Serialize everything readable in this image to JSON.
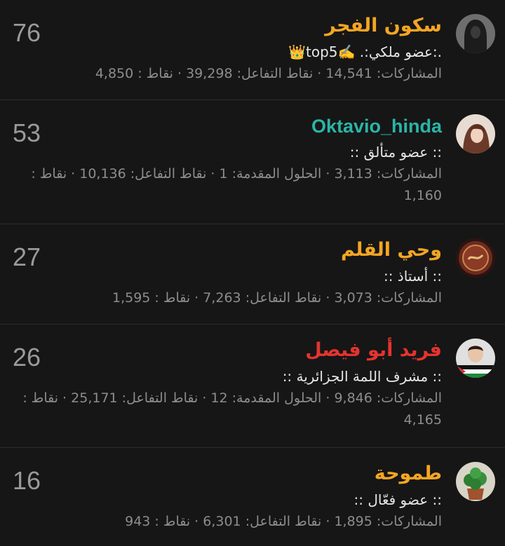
{
  "colors": {
    "gold": "#f5a623",
    "teal": "#2bb5a6",
    "red": "#e5332f"
  },
  "members": [
    {
      "score": "76",
      "name": "سكون الفجر",
      "name_color": "#f5a623",
      "rank": ".:عضو ملكي:. ✍️top5👑",
      "stats": "المشاركات: 14,541 · نقاط التفاعل: 39,298 · نقاط : 4,850",
      "avatar_icon": "hooded-figure-avatar"
    },
    {
      "score": "53",
      "name": "Oktavio_hinda",
      "name_color": "#2bb5a6",
      "rank": ":: عضو متألق ::",
      "stats": "المشاركات: 3,113 · الحلول المقدمة: 1 · نقاط التفاعل: 10,136 · نقاط : 1,160",
      "avatar_icon": "girl-portrait-avatar"
    },
    {
      "score": "27",
      "name": "وحي القلم",
      "name_color": "#f5a623",
      "rank": ":: أستاذ ::",
      "stats": "المشاركات: 3,073 · نقاط التفاعل: 7,263 · نقاط : 1,595",
      "avatar_icon": "calligraphy-medallion-avatar"
    },
    {
      "score": "26",
      "name": "فريد أبو فيصل",
      "name_color": "#e5332f",
      "rank": ":: مشرف اللمة الجزائرية ::",
      "stats": "المشاركات: 9,846 · الحلول المقدمة: 12 · نقاط التفاعل: 25,171 · نقاط : 4,165",
      "avatar_icon": "child-palestine-flag-avatar"
    },
    {
      "score": "16",
      "name": "طموحة",
      "name_color": "#f5a623",
      "rank": ":: عضو فعّال ::",
      "stats": "المشاركات: 1,895 · نقاط التفاعل: 6,301 · نقاط : 943",
      "avatar_icon": "potted-plant-avatar"
    }
  ]
}
